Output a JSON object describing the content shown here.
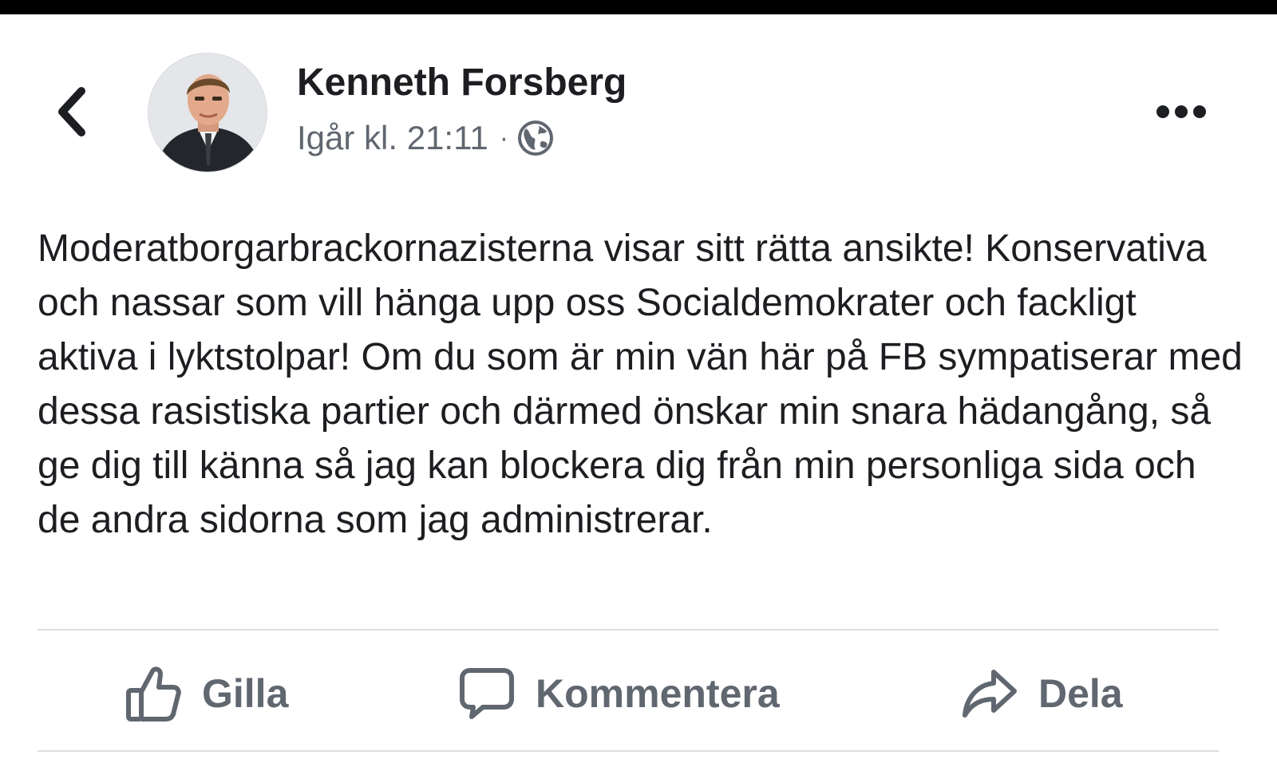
{
  "post": {
    "author": "Kenneth Forsberg",
    "timestamp": "Igår kl. 21:11",
    "separator": "·",
    "audience_icon": "globe-icon",
    "text": "Moderatborgarbrackornazisterna visar sitt rätta ansikte! Konservativa och nassar som vill hänga upp oss Socialdemokrater och fackligt aktiva i lyktstolpar! Om du som är min vän här på FB sympatiserar med dessa rasistiska partier och därmed önskar min snara hädangång, så ge dig till känna så jag kan blockera dig från min personliga sida och de andra sidorna som jag administrerar."
  },
  "actions": {
    "like_label": "Gilla",
    "comment_label": "Kommentera",
    "share_label": "Dela"
  },
  "icons": {
    "back": "chevron-left-icon",
    "more": "more-horizontal-icon",
    "like": "thumbs-up-icon",
    "comment": "speech-bubble-icon",
    "share": "share-arrow-icon"
  },
  "colors": {
    "text": "#1c1e21",
    "secondary": "#616770",
    "action": "#606770",
    "divider": "#dadde1",
    "top_bar": "#000000"
  }
}
